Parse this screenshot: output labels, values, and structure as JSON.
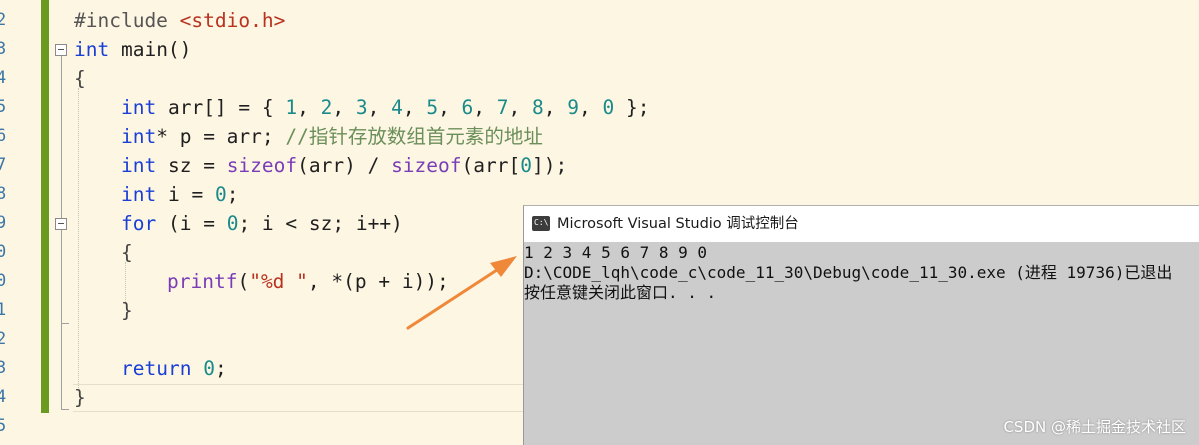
{
  "editor": {
    "line_numbers": [
      "2",
      "3",
      "4",
      "5",
      "6",
      "7",
      "8",
      "9",
      "0",
      "0",
      "1",
      "2",
      "3",
      "4",
      "5"
    ],
    "lines": {
      "l1": {
        "kw": "#include ",
        "inc": "<stdio.h>"
      },
      "l2": {
        "kw": "int",
        "rest": " main()"
      },
      "l3": {
        "brace": "{"
      },
      "l4": {
        "kw": "int",
        "p1": " arr[] = { ",
        "n1": "1",
        "c1": ", ",
        "n2": "2",
        "c2": ", ",
        "n3": "3",
        "c3": ", ",
        "n4": "4",
        "c4": ", ",
        "n5": "5",
        "c5": ", ",
        "n6": "6",
        "c6": ", ",
        "n7": "7",
        "c7": ", ",
        "n8": "8",
        "c8": ", ",
        "n9": "9",
        "c9": ", ",
        "n10": "0",
        "end": " };"
      },
      "l5": {
        "kw": "int",
        "rest": "* p = arr; ",
        "cmt": "//指针存放数组首元素的地址"
      },
      "l6": {
        "kw": "int",
        "p1": " sz = ",
        "fn1": "sizeof",
        "p2": "(arr) / ",
        "fn2": "sizeof",
        "p3": "(arr[",
        "n": "0",
        "p4": "]);"
      },
      "l7": {
        "kw": "int",
        "p1": " i = ",
        "n": "0",
        "p2": ";"
      },
      "l8": {
        "kw": "for",
        "p1": " (i = ",
        "n": "0",
        "p2": "; i < sz; i++)"
      },
      "l9": {
        "brace": "{"
      },
      "l10": {
        "fn": "printf",
        "p1": "(",
        "str": "\"%d \"",
        "p2": ", *(p + i));"
      },
      "l11": {
        "brace": "}"
      },
      "l12": {
        "kw": "return",
        "p1": " ",
        "n": "0",
        "p2": ";"
      },
      "l13": {
        "brace": "}"
      }
    }
  },
  "console": {
    "title": "Microsoft Visual Studio 调试控制台",
    "icon": "console-app-icon",
    "icon_text": "C:\\",
    "output": [
      "1 2 3 4 5 6 7 8 9 0",
      "D:\\CODE_lqh\\code_c\\code_11_30\\Debug\\code_11_30.exe (进程 19736)已退出",
      "按任意键关闭此窗口. . ."
    ],
    "watermark": "CSDN @稀土掘金技术社区"
  },
  "colors": {
    "editor_bg": "#fdf6e3",
    "keyword": "#1a3fd6",
    "number": "#1a8a8a",
    "function": "#7a3db8",
    "string": "#b8321f",
    "comment": "#6b8f5a",
    "arrow": "#f0883a",
    "console_bg": "#cccccc"
  }
}
